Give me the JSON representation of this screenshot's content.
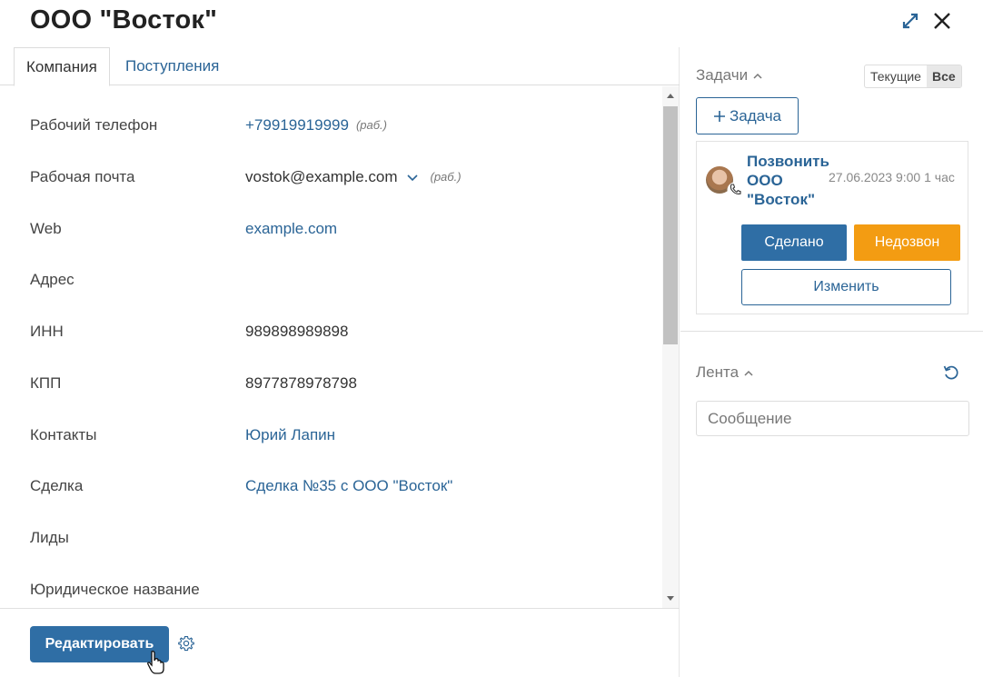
{
  "header": {
    "title": "ООО \"Восток\""
  },
  "tabs": [
    {
      "label": "Компания"
    },
    {
      "label": "Поступления"
    }
  ],
  "fields": [
    {
      "label": "Рабочий телефон",
      "value": "+79919919999",
      "tag": "(раб.)"
    },
    {
      "label": "Рабочая почта",
      "value": "vostok@example.com",
      "tag": "(раб.)"
    },
    {
      "label": "Web",
      "value": "example.com"
    },
    {
      "label": "Адрес",
      "value": ""
    },
    {
      "label": "ИНН",
      "value": "989898989898"
    },
    {
      "label": "КПП",
      "value": "8977878978798"
    },
    {
      "label": "Контакты",
      "value": "Юрий Лапин"
    },
    {
      "label": "Сделка",
      "value": "Сделка №35 с ООО \"Восток\""
    },
    {
      "label": "Лиды",
      "value": ""
    },
    {
      "label": "Юридическое название",
      "value": ""
    }
  ],
  "footer": {
    "edit_label": "Редактировать"
  },
  "tasks": {
    "title": "Задачи",
    "toggle_current": "Текущие",
    "toggle_all": "Все",
    "add_label": "Задача",
    "card": {
      "title": "Позвонить ООО \"Восток\"",
      "meta": "27.06.2023 9:00 1 час",
      "done_label": "Сделано",
      "miss_label": "Недозвон",
      "change_label": "Изменить"
    }
  },
  "feed": {
    "title": "Лента",
    "placeholder": "Сообщение"
  },
  "colors": {
    "primary": "#2f6ea5",
    "link": "#2a6496",
    "warning": "#f39c12"
  }
}
